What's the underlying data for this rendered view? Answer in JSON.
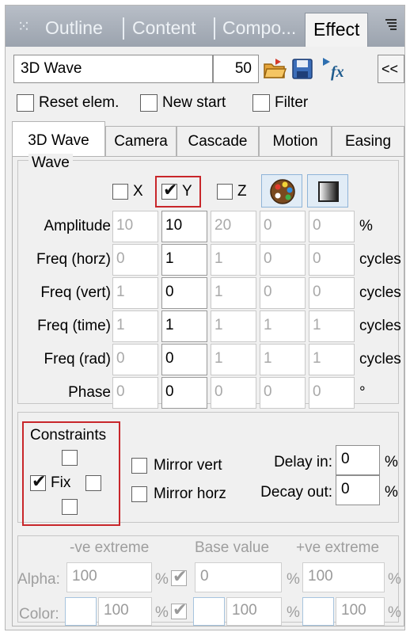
{
  "header": {
    "tabs": [
      "Outline",
      "Content",
      "Compo...",
      "Effect"
    ],
    "active_tab": "Effect",
    "grip_icon": "grip-icon",
    "menu_icon": "panel-menu-icon"
  },
  "toolbar": {
    "effect_name": "3D Wave",
    "effect_value": "50",
    "collapse_label": "<<",
    "icons": [
      "open-folder-icon",
      "save-disk-icon",
      "fx-icon"
    ]
  },
  "options": {
    "reset_label": "Reset elem.",
    "new_start_label": "New start",
    "filter_label": "Filter"
  },
  "tabs": [
    "3D Wave",
    "Camera",
    "Cascade",
    "Motion",
    "Easing"
  ],
  "active_subtab": "3D Wave",
  "wave": {
    "title": "Wave",
    "axes": [
      {
        "label": "X",
        "checked": false
      },
      {
        "label": "Y",
        "checked": true
      },
      {
        "label": "Z",
        "checked": false
      }
    ],
    "check_mark": "✔",
    "rows": [
      {
        "label": "Amplitude",
        "values": [
          "10",
          "10",
          "20",
          "0",
          "0"
        ],
        "unit": "%"
      },
      {
        "label": "Freq (horz)",
        "values": [
          "0",
          "1",
          "1",
          "0",
          "0"
        ],
        "unit": "cycles"
      },
      {
        "label": "Freq (vert)",
        "values": [
          "1",
          "0",
          "1",
          "0",
          "0"
        ],
        "unit": "cycles"
      },
      {
        "label": "Freq (time)",
        "values": [
          "1",
          "1",
          "1",
          "1",
          "1"
        ],
        "unit": "cycles"
      },
      {
        "label": "Freq (rad)",
        "values": [
          "0",
          "0",
          "1",
          "1",
          "1"
        ],
        "unit": "cycles"
      },
      {
        "label": "Phase",
        "values": [
          "0",
          "0",
          "0",
          "0",
          "0"
        ],
        "unit": "°"
      }
    ]
  },
  "constraints": {
    "title": "Constraints",
    "fix_label": "Fix",
    "fix_checked": true,
    "mirror_vert_label": "Mirror vert",
    "mirror_horz_label": "Mirror horz",
    "delay_in_label": "Delay in:",
    "delay_in_value": "0",
    "decay_out_label": "Decay out:",
    "decay_out_value": "0",
    "percent": "%"
  },
  "extremes": {
    "header_neg": "-ve extreme",
    "header_base": "Base value",
    "header_pos": "+ve extreme",
    "alpha_label": "Alpha:",
    "alpha_neg": "100",
    "alpha_base": "0",
    "alpha_pos": "100",
    "color_label": "Color:",
    "color_neg": "100",
    "color_base": "100",
    "color_pos": "100",
    "percent": "%"
  }
}
